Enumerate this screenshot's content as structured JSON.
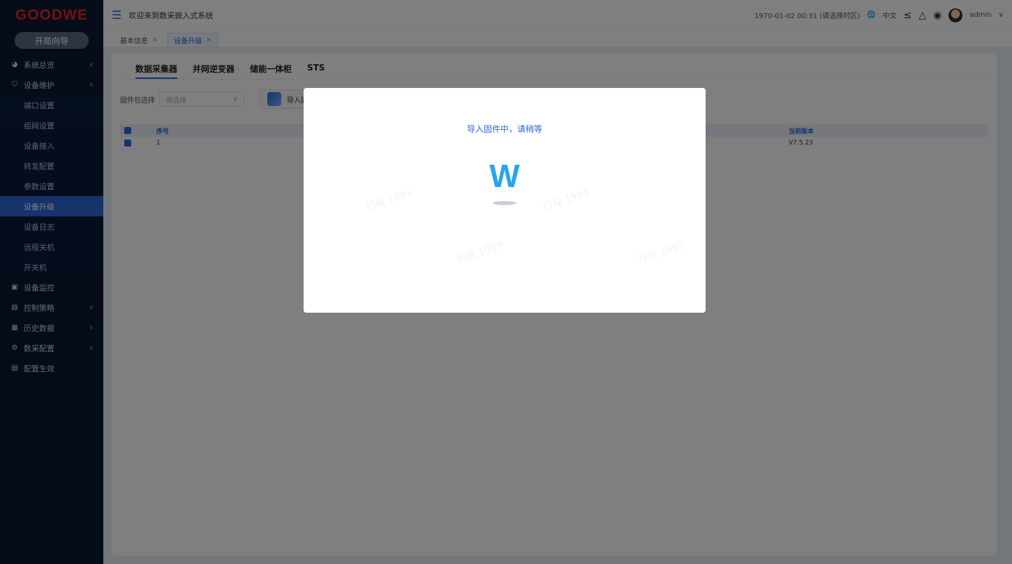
{
  "brand": {
    "logo": "GOODWE"
  },
  "sidebar": {
    "wizard_button": "开局向导",
    "items": [
      {
        "label": "系统总览",
        "icon": "dashboard-icon",
        "chevron": "∨"
      },
      {
        "label": "设备维护",
        "icon": "shield-icon",
        "chevron": "∧"
      }
    ],
    "subitems": [
      "端口设置",
      "组网设置",
      "设备接入",
      "转发配置",
      "参数设置",
      "设备升级",
      "设备日志",
      "远程关机",
      "开关机"
    ],
    "active_subitem": "设备升级",
    "items_after": [
      {
        "label": "设备监控",
        "icon": "monitor-icon",
        "chevron": ""
      },
      {
        "label": "控制策略",
        "icon": "strategy-icon",
        "chevron": "∨"
      },
      {
        "label": "历史数据",
        "icon": "history-icon",
        "chevron": "∨"
      },
      {
        "label": "数采配置",
        "icon": "config-icon",
        "chevron": "∨"
      },
      {
        "label": "配置生效",
        "icon": "apply-icon",
        "chevron": ""
      }
    ]
  },
  "header": {
    "title": "欢迎来到数采嵌入式系统",
    "datetime": "1970-01-02 00:31 (请选择时区)",
    "language": "中文",
    "user": "admin"
  },
  "tabs": [
    {
      "label": "基本信息",
      "close": "×"
    },
    {
      "label": "设备升级",
      "close": "×"
    }
  ],
  "main": {
    "subtabs": [
      "数据采集器",
      "并网逆变器",
      "储能一体柜",
      "STS"
    ],
    "firmware_label": "固件包选择",
    "firmware_placeholder": "请选择",
    "import_button": "导入固件包",
    "table": {
      "headers": {
        "index": "序号",
        "version": "当前版本"
      },
      "rows": [
        {
          "index": "1",
          "version": "V7.5.23"
        }
      ]
    }
  },
  "modal": {
    "message": "导入固件中，请稍等",
    "loader_glyph": "W"
  },
  "watermark": "行採 1993",
  "colors": {
    "accent": "#2f66d9",
    "brand_red": "#e3262d",
    "sidebar_bg": "#0d1a33"
  }
}
